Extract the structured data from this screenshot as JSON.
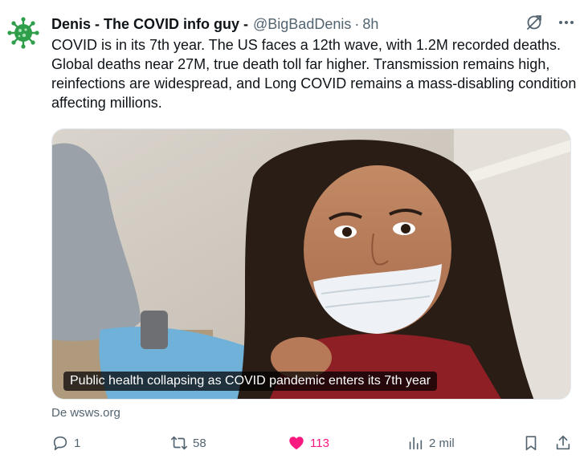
{
  "tweet": {
    "display_name": "Denis - The COVID info guy -",
    "handle": "@BigBadDenis",
    "separator": "·",
    "time": "8h",
    "text": "COVID is in its 7th year. The US faces a 12th wave, with 1.2M recorded deaths. Global deaths near 27M, true death toll far higher. Transmission remains high, reinfections are widespread, and Long COVID remains a mass-disabling condition affecting millions.",
    "media": {
      "caption": "Public health collapsing as COVID pandemic enters its 7th year"
    },
    "source": "De wsws.org"
  },
  "header_icons": [
    "grok-icon",
    "more-icon"
  ],
  "actions": {
    "reply": {
      "icon": "reply-icon",
      "count": "1"
    },
    "retweet": {
      "icon": "retweet-icon",
      "count": "58"
    },
    "like": {
      "icon": "heart-icon",
      "count": "113",
      "color": "#f91880"
    },
    "views": {
      "icon": "views-icon",
      "count": "2 mil"
    },
    "bookmark": {
      "icon": "bookmark-icon"
    },
    "share": {
      "icon": "share-icon"
    }
  },
  "colors": {
    "text": "#0f1419",
    "secondary": "#536471",
    "like_active": "#f91880",
    "avatar_green": "#2e9e4a"
  }
}
